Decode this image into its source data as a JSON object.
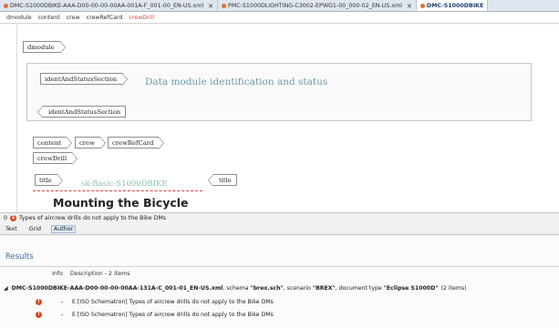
{
  "tabs": [
    {
      "label": "DMC-S1000DBIKE-AAA-D00-00-00-00AA-001A-F_001-00_EN-US.xml",
      "active": false
    },
    {
      "label": "PMC-S1000DLIGHTING-C3002-EPWG1-00_000-02_EN-US.xml",
      "active": false
    },
    {
      "label": "DMC-S1000DBIKE",
      "active": true
    }
  ],
  "breadcrumb": [
    "dmodule",
    "content",
    "crew",
    "crewRefCard",
    "crewDrill"
  ],
  "editor": {
    "dmodule_tag": "dmodule",
    "ident_open": "identAndStatusSection",
    "ident_title": "Data module identification and status",
    "ident_close": "identAndStatusSection",
    "content_tag": "content",
    "crew_tag": "crew",
    "crewrefcard_tag": "crewRefCard",
    "crewdrill_tag": "crewDrill",
    "brex_ref": "sk-Basic-S1000DBIKE",
    "title_open": "title",
    "title_text": "Mounting the Bicycle",
    "title_close": "title"
  },
  "status": {
    "count": "0",
    "error_count": "1",
    "message": "Types of aircrew drills do not apply to the Bike DMs"
  },
  "modes": [
    "Text",
    "Grid",
    "Author"
  ],
  "results": {
    "title": "Results",
    "col_info": "Info",
    "col_desc": "Description - 2 items",
    "group": {
      "prefix": "DMC-S1000DBIKE-AAA-D00-00-00-00AA-131A-C_001-01_EN-US.xml",
      "schema_label": ", schema ",
      "schema": "\"brex.sch\"",
      "scenario_label": ", scenario ",
      "scenario": "\"BREX\"",
      "doctype_label": ", document type ",
      "doctype": "\"Eclipse S1000D\"",
      "count": "(2 items)"
    },
    "items": [
      {
        "severity": "error",
        "dash": "–",
        "text": "E [ISO Schematron] Types of aircrew drills do not apply to the Bike DMs"
      },
      {
        "severity": "error",
        "dash": "–",
        "text": "E [ISO Schematron] Types of aircrew drills do not apply to the Bike DMs"
      }
    ]
  }
}
